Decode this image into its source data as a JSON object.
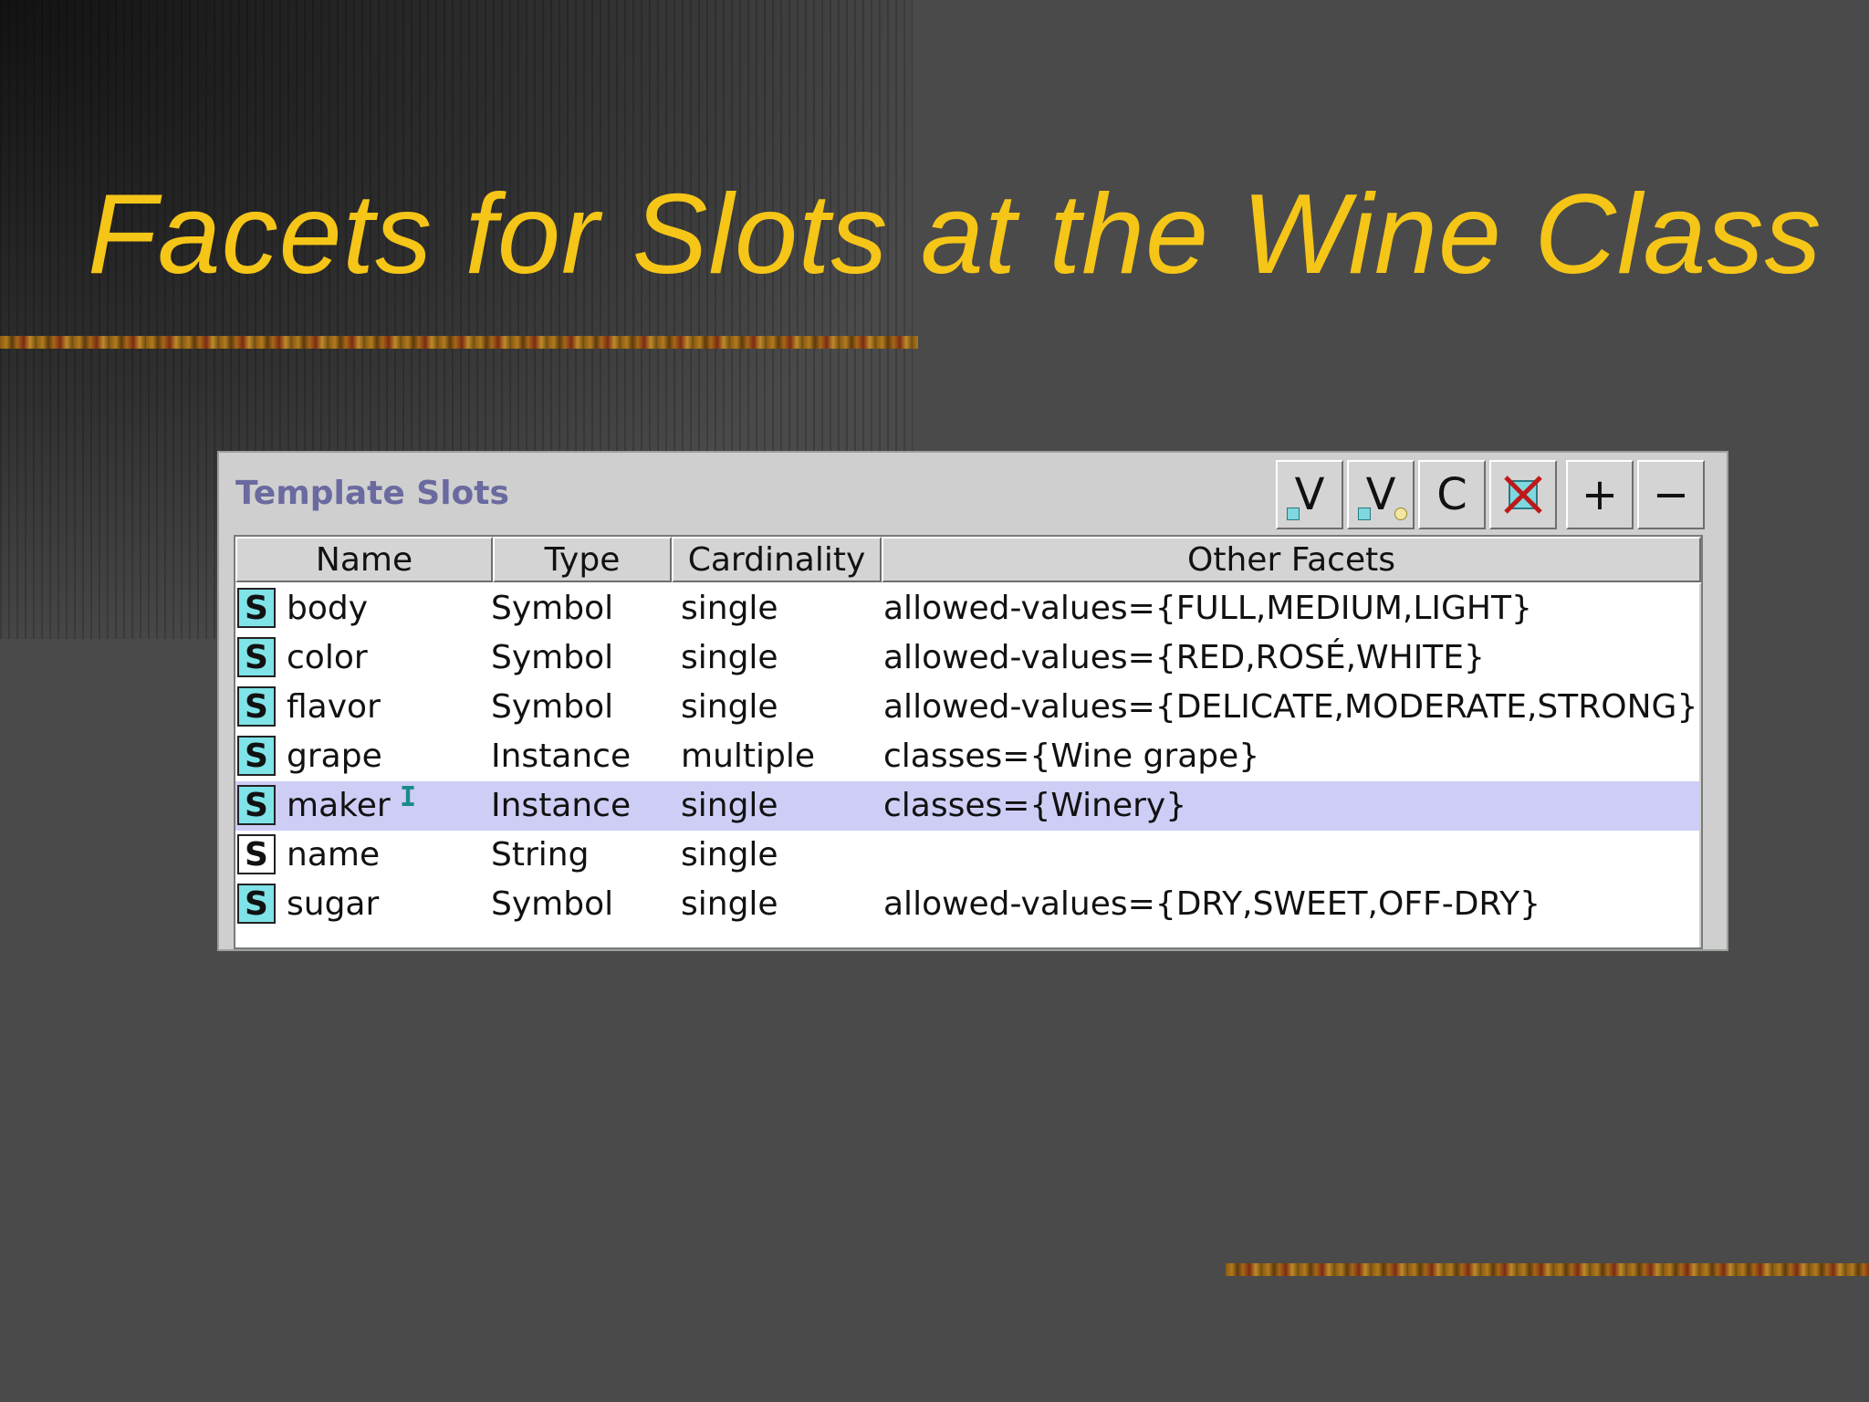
{
  "title": "Facets for Slots at the Wine Class",
  "panel": {
    "label": "Template Slots",
    "toolbar": [
      {
        "label": "V",
        "icon": "view-slot-icon"
      },
      {
        "label": "V",
        "icon": "view-facet-icon"
      },
      {
        "label": "C",
        "icon": "create-slot-icon"
      },
      {
        "label": "X",
        "icon": "delete-slot-icon"
      },
      {
        "label": "+",
        "icon": "add-slot-icon"
      },
      {
        "label": "−",
        "icon": "remove-slot-icon"
      }
    ]
  },
  "table": {
    "columns": [
      "Name",
      "Type",
      "Cardinality",
      "Other Facets"
    ],
    "rows": [
      {
        "icon": "S",
        "name": "body",
        "type": "Symbol",
        "cardinality": "single",
        "facets": "allowed-values={FULL,MEDIUM,LIGHT}"
      },
      {
        "icon": "S",
        "name": "color",
        "type": "Symbol",
        "cardinality": "single",
        "facets": "allowed-values={RED,ROSÉ,WHITE}"
      },
      {
        "icon": "S",
        "name": "flavor",
        "type": "Symbol",
        "cardinality": "single",
        "facets": "allowed-values={DELICATE,MODERATE,STRONG}"
      },
      {
        "icon": "S",
        "name": "grape",
        "type": "Instance",
        "cardinality": "multiple",
        "facets": "classes={Wine grape}"
      },
      {
        "icon": "S",
        "name": "maker",
        "type": "Instance",
        "cardinality": "single",
        "facets": "classes={Winery}"
      },
      {
        "icon": "S",
        "name": "name",
        "type": "String",
        "cardinality": "single",
        "facets": ""
      },
      {
        "icon": "S",
        "name": "sugar",
        "type": "Symbol",
        "cardinality": "single",
        "facets": "allowed-values={DRY,SWEET,OFF-DRY}"
      }
    ],
    "selected_row": "maker",
    "cursor_glyph": "I",
    "icon_colors": {
      "own_slot": "#7fe3e8",
      "inherited_slot": "#ffffff",
      "selection": "#cdcdf5"
    }
  }
}
